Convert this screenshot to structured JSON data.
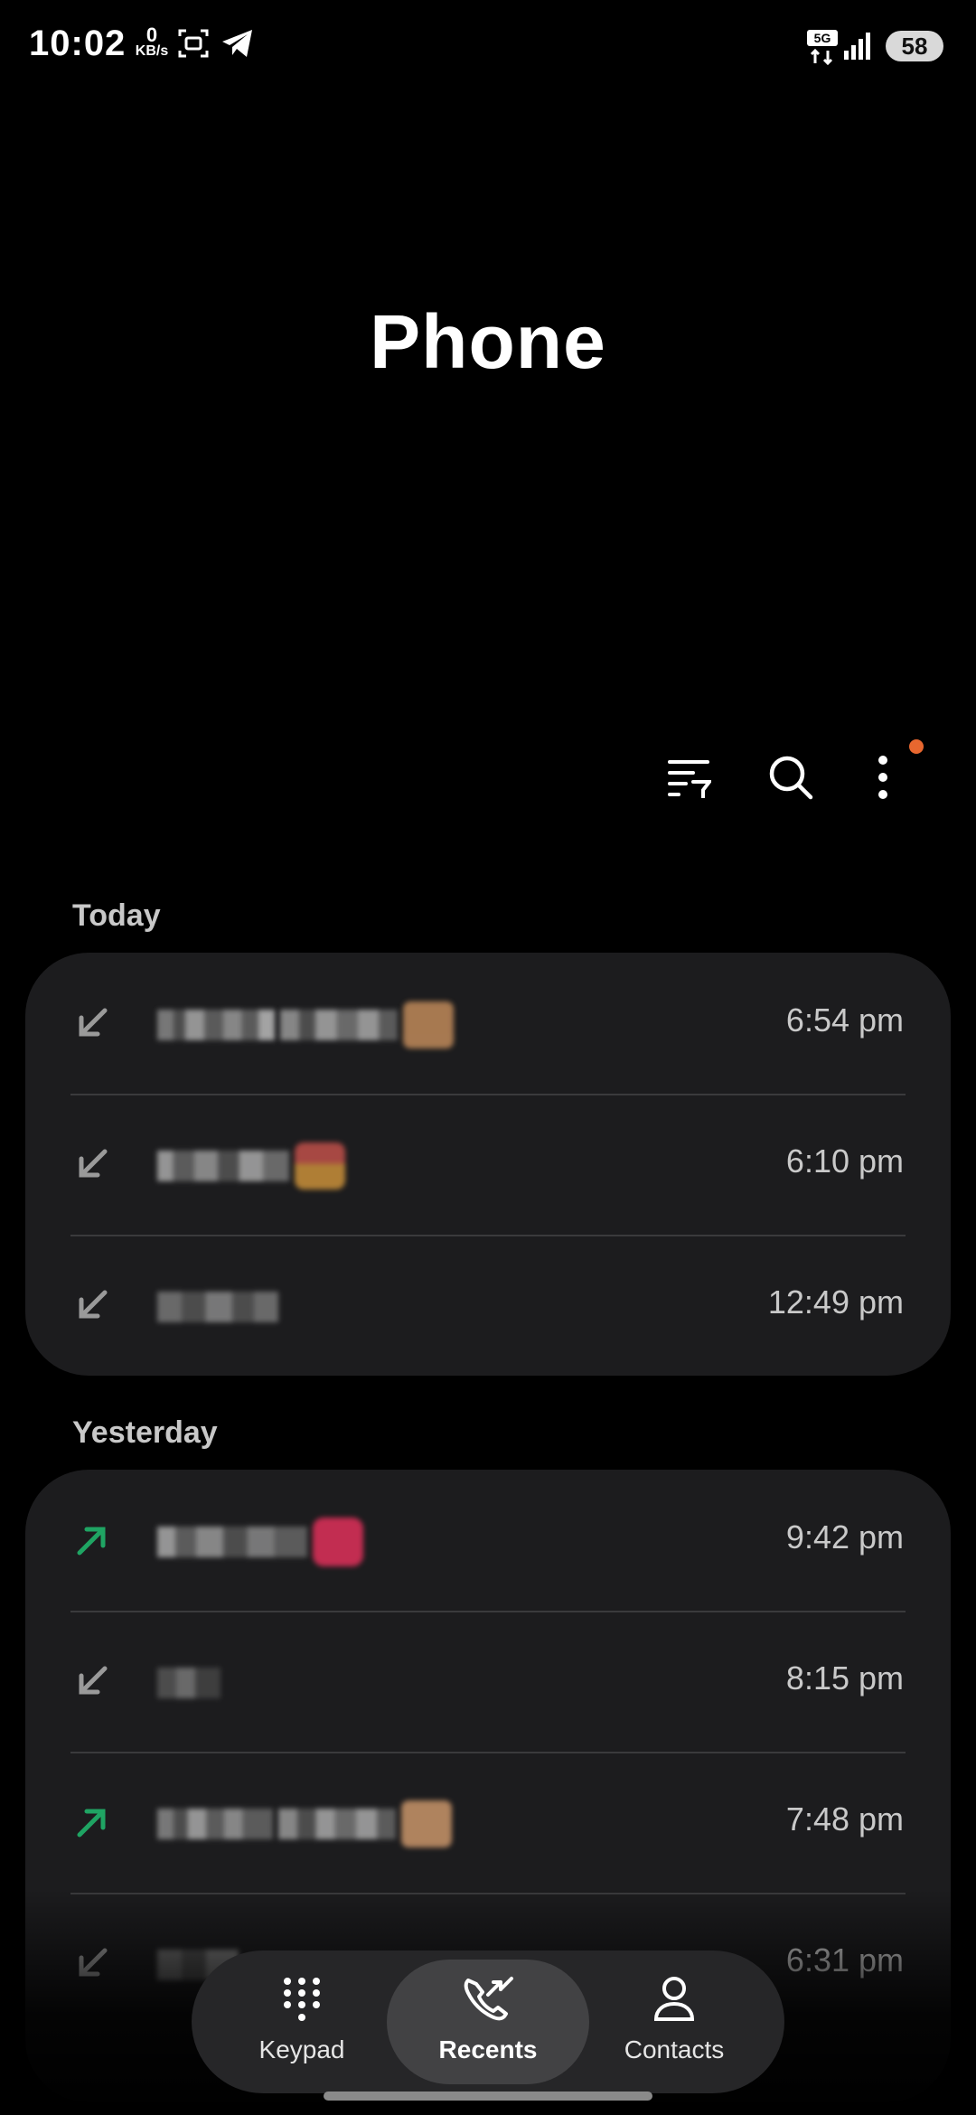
{
  "status_bar": {
    "time": "10:02",
    "net_speed_value": "0",
    "net_speed_unit": "KB/s",
    "network_type": "5G",
    "battery": "58"
  },
  "header": {
    "title": "Phone"
  },
  "toolbar": {
    "filter_icon": "filter-list-icon",
    "search_icon": "search-icon",
    "more_icon": "more-vertical-icon",
    "notification_color": "#e8672f"
  },
  "sections": [
    {
      "label": "Today",
      "calls": [
        {
          "direction": "incoming",
          "time": "6:54 pm"
        },
        {
          "direction": "incoming",
          "time": "6:10 pm"
        },
        {
          "direction": "incoming",
          "time": "12:49 pm"
        }
      ]
    },
    {
      "label": "Yesterday",
      "calls": [
        {
          "direction": "outgoing",
          "time": "9:42 pm"
        },
        {
          "direction": "incoming",
          "time": "8:15 pm"
        },
        {
          "direction": "outgoing",
          "time": "7:48 pm"
        },
        {
          "direction": "incoming",
          "time": "6:31 pm"
        }
      ]
    }
  ],
  "colors": {
    "incoming_arrow": "#9a9a9a",
    "outgoing_arrow": "#1fa463",
    "card_bg": "#1c1c1e",
    "nav_active_bg": "#424244"
  },
  "bottom_nav": {
    "keypad": "Keypad",
    "recents": "Recents",
    "contacts": "Contacts",
    "active": "recents"
  }
}
